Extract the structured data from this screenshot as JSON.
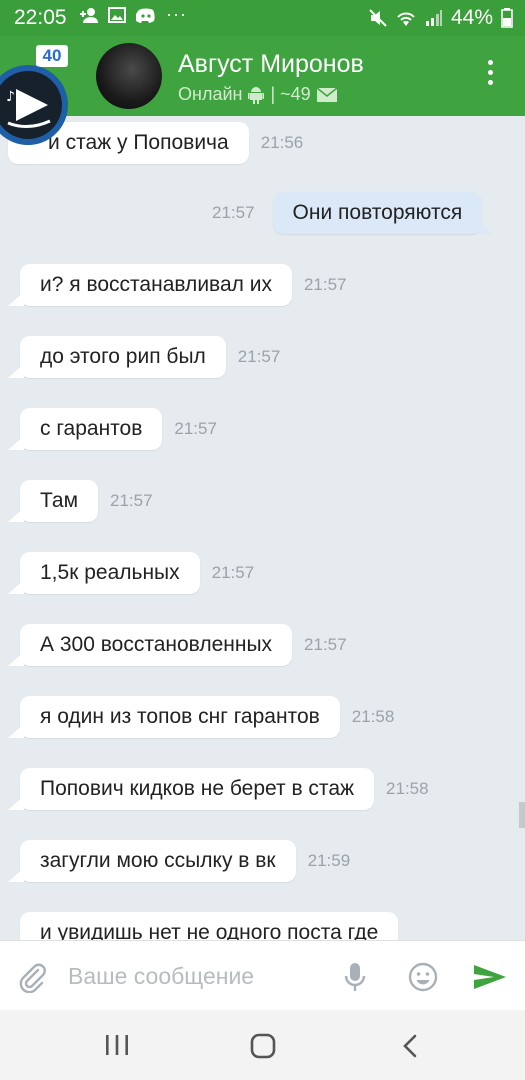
{
  "status_bar": {
    "time": "22:05",
    "battery": "44%"
  },
  "header": {
    "name": "Август Миронов",
    "status": "Онлайн",
    "counter": "| ~49",
    "badge": "40"
  },
  "messages": [
    {
      "dir": "in",
      "text": "и стаж у Поповича",
      "time": "21:56"
    },
    {
      "dir": "out",
      "text": "Они повторяются",
      "time": "21:57"
    },
    {
      "dir": "in",
      "text": "и? я восстанавливал их",
      "time": "21:57"
    },
    {
      "dir": "in",
      "text": "до этого рип был",
      "time": "21:57"
    },
    {
      "dir": "in",
      "text": "с гарантов",
      "time": "21:57"
    },
    {
      "dir": "in",
      "text": "Там",
      "time": "21:57"
    },
    {
      "dir": "in",
      "text": "1,5к реальных",
      "time": "21:57"
    },
    {
      "dir": "in",
      "text": "А 300 восстановленных",
      "time": "21:57"
    },
    {
      "dir": "in",
      "text": "я один из топов снг гарантов",
      "time": "21:58"
    },
    {
      "dir": "in",
      "text": "Попович кидков не берет в стаж",
      "time": "21:58"
    },
    {
      "dir": "in",
      "text": "загугли мою ссылку в вк",
      "time": "21:59"
    },
    {
      "dir": "in",
      "text": "и увидишь нет не одного поста где",
      "time": ""
    }
  ],
  "input": {
    "placeholder": "Ваше сообщение"
  },
  "colors": {
    "header_green": "#3fa33f",
    "status_green": "#3a9e3a",
    "outgoing_bubble": "#dbe8f8",
    "chat_background": "#e6ebf0",
    "send_icon": "#3fa33f"
  },
  "icons": [
    "add-person-icon",
    "image-icon",
    "discord-icon",
    "more-icon",
    "mute-icon",
    "wifi-icon",
    "signal-icon",
    "battery-icon",
    "android-icon",
    "mail-icon",
    "kebab-menu-icon",
    "attach-icon",
    "microphone-icon",
    "emoji-icon",
    "send-icon",
    "recent-apps-icon",
    "home-icon",
    "back-icon"
  ]
}
